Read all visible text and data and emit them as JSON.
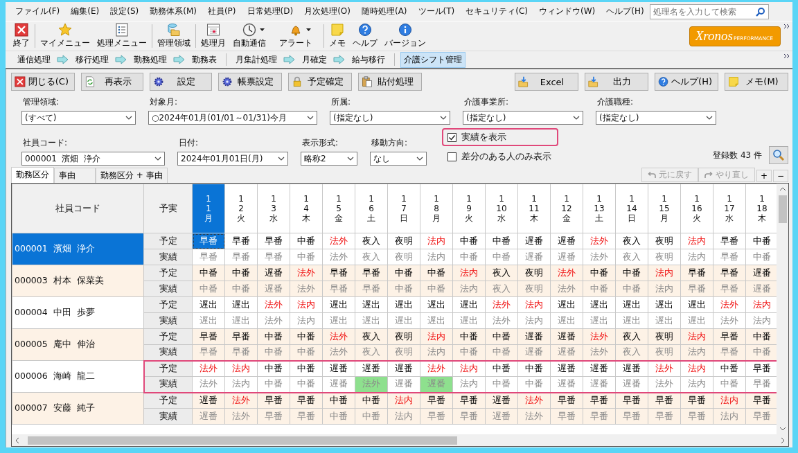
{
  "menu": [
    "ファイル(F)",
    "編集(E)",
    "設定(S)",
    "勤務体系(M)",
    "社員(P)",
    "日常処理(D)",
    "月次処理(O)",
    "随時処理(A)",
    "ツール(T)",
    "セキュリティ(C)",
    "ウィンドウ(W)",
    "ヘルプ(H)"
  ],
  "search": {
    "placeholder": "処理名を入力して検索"
  },
  "toolbar": [
    {
      "label": "終了",
      "dropdown": false
    },
    {
      "label": "マイメニュー",
      "dropdown": false
    },
    {
      "label": "処理メニュー",
      "dropdown": false
    },
    {
      "label": "管理領域",
      "dropdown": false
    },
    {
      "label": "処理月",
      "dropdown": false
    },
    {
      "label": "自動通信",
      "dropdown": true
    },
    {
      "label": "アラート",
      "dropdown": true
    },
    {
      "label": "メモ",
      "dropdown": false
    },
    {
      "label": "ヘルプ",
      "dropdown": false
    },
    {
      "label": "バージョン",
      "dropdown": false
    }
  ],
  "logo": {
    "name": "Xronos",
    "tagline": "PERFORMANCE"
  },
  "breadcrumb": [
    [
      {
        "label": "通信処理",
        "selected": false
      },
      {
        "label": "移行処理",
        "selected": false
      },
      {
        "label": "勤務処理",
        "selected": false
      },
      {
        "label": "勤務表",
        "selected": false
      }
    ],
    [
      {
        "label": "月集計処理",
        "selected": false
      },
      {
        "label": "月確定",
        "selected": false
      },
      {
        "label": "給与移行",
        "selected": false
      }
    ],
    [
      {
        "label": "介護シフト管理",
        "selected": true
      }
    ]
  ],
  "actions_left": [
    "閉じる(C)",
    "再表示",
    "設定",
    "帳票設定",
    "予定確定",
    "貼付処理"
  ],
  "actions_right": [
    "Excel",
    "出力",
    "ヘルプ(H)",
    "メモ(M)"
  ],
  "filters_row1": [
    {
      "label": "管理領域:",
      "value": "(すべて)"
    },
    {
      "label": "対象月:",
      "value": "○2024年01月(01/01～01/31)今月"
    },
    {
      "label": "所属:",
      "value": "(指定なし)"
    },
    {
      "label": "介護事業所:",
      "value": "(指定なし)"
    },
    {
      "label": "介護職種:",
      "value": "(指定なし)"
    }
  ],
  "filters_row2": [
    {
      "label": "社員コード:",
      "value": "000001  濱畑  浄介"
    },
    {
      "label": "日付:",
      "value": "2024年01月01日(月)"
    },
    {
      "label": "表示形式:",
      "value": "略称2"
    },
    {
      "label": "移動方向:",
      "value": "なし"
    }
  ],
  "checkboxes": [
    {
      "label": "実績を表示",
      "checked": true,
      "highlighted": true
    },
    {
      "label": "差分のある人のみ表示",
      "checked": false,
      "highlighted": false
    }
  ],
  "record_count": {
    "label": "登録数",
    "count": "43",
    "unit": "件"
  },
  "history_buttons": [
    {
      "label": "元に戻す",
      "disabled": true
    },
    {
      "label": "やり直し",
      "disabled": true
    }
  ],
  "zoom_buttons": [
    "+",
    "−"
  ],
  "tabs": [
    {
      "label": "勤務区分",
      "selected": true
    },
    {
      "label": "事由",
      "selected": false
    },
    {
      "label": "勤務区分 + 事由",
      "selected": false
    }
  ],
  "grid": {
    "columns": [
      "社員コード",
      "予実"
    ],
    "days": [
      {
        "month": "1",
        "day": "1",
        "weekday": "月",
        "selected": true
      },
      {
        "month": "1",
        "day": "2",
        "weekday": "火",
        "selected": false
      },
      {
        "month": "1",
        "day": "3",
        "weekday": "水",
        "selected": false
      },
      {
        "month": "1",
        "day": "4",
        "weekday": "木",
        "selected": false
      },
      {
        "month": "1",
        "day": "5",
        "weekday": "金",
        "selected": false
      },
      {
        "month": "1",
        "day": "6",
        "weekday": "土",
        "selected": false
      },
      {
        "month": "1",
        "day": "7",
        "weekday": "日",
        "selected": false
      },
      {
        "month": "1",
        "day": "8",
        "weekday": "月",
        "selected": false
      },
      {
        "month": "1",
        "day": "9",
        "weekday": "火",
        "selected": false
      },
      {
        "month": "1",
        "day": "10",
        "weekday": "水",
        "selected": false
      },
      {
        "month": "1",
        "day": "11",
        "weekday": "木",
        "selected": false
      },
      {
        "month": "1",
        "day": "12",
        "weekday": "金",
        "selected": false
      },
      {
        "month": "1",
        "day": "13",
        "weekday": "土",
        "selected": false
      },
      {
        "month": "1",
        "day": "14",
        "weekday": "日",
        "selected": false
      },
      {
        "month": "1",
        "day": "15",
        "weekday": "月",
        "selected": false
      },
      {
        "month": "1",
        "day": "16",
        "weekday": "火",
        "selected": false
      },
      {
        "month": "1",
        "day": "17",
        "weekday": "水",
        "selected": false
      },
      {
        "month": "1",
        "day": "18",
        "weekday": "木",
        "selected": false
      }
    ],
    "employees": [
      {
        "name": "000001  濱畑  浄介",
        "selected": true,
        "highlighted": false,
        "labels": [
          "予定",
          "実績"
        ],
        "plan": [
          {
            "text": "早番",
            "holiday": false
          },
          {
            "text": "早番",
            "holiday": false
          },
          {
            "text": "早番",
            "holiday": false
          },
          {
            "text": "中番",
            "holiday": false
          },
          {
            "text": "法外",
            "holiday": true
          },
          {
            "text": "夜入",
            "holiday": false
          },
          {
            "text": "夜明",
            "holiday": false
          },
          {
            "text": "法内",
            "holiday": true
          },
          {
            "text": "中番",
            "holiday": false
          },
          {
            "text": "中番",
            "holiday": false
          },
          {
            "text": "遅番",
            "holiday": false
          },
          {
            "text": "遅番",
            "holiday": false
          },
          {
            "text": "法外",
            "holiday": true
          },
          {
            "text": "夜入",
            "holiday": false
          },
          {
            "text": "夜明",
            "holiday": false
          },
          {
            "text": "法内",
            "holiday": true
          },
          {
            "text": "早番",
            "holiday": false
          },
          {
            "text": "中番",
            "holiday": false
          }
        ],
        "actual": [
          {
            "text": "早番",
            "differs": false
          },
          {
            "text": "早番",
            "differs": false
          },
          {
            "text": "早番",
            "differs": false
          },
          {
            "text": "中番",
            "differs": false
          },
          {
            "text": "法外",
            "differs": false
          },
          {
            "text": "夜入",
            "differs": false
          },
          {
            "text": "夜明",
            "differs": false
          },
          {
            "text": "法内",
            "differs": false
          },
          {
            "text": "中番",
            "differs": false
          },
          {
            "text": "中番",
            "differs": false
          },
          {
            "text": "遅番",
            "differs": false
          },
          {
            "text": "遅番",
            "differs": false
          },
          {
            "text": "法外",
            "differs": false
          },
          {
            "text": "夜入",
            "differs": false
          },
          {
            "text": "夜明",
            "differs": false
          },
          {
            "text": "法内",
            "differs": false
          },
          {
            "text": "早番",
            "differs": false
          },
          {
            "text": "中番",
            "differs": false
          }
        ]
      },
      {
        "name": "000003  村本  保菜美",
        "selected": false,
        "highlighted": false,
        "labels": [
          "予定",
          "実績"
        ],
        "plan": [
          {
            "text": "中番",
            "holiday": false
          },
          {
            "text": "中番",
            "holiday": false
          },
          {
            "text": "遅番",
            "holiday": false
          },
          {
            "text": "法外",
            "holiday": true
          },
          {
            "text": "早番",
            "holiday": false
          },
          {
            "text": "早番",
            "holiday": false
          },
          {
            "text": "中番",
            "holiday": false
          },
          {
            "text": "中番",
            "holiday": false
          },
          {
            "text": "法内",
            "holiday": true
          },
          {
            "text": "夜入",
            "holiday": false
          },
          {
            "text": "夜明",
            "holiday": false
          },
          {
            "text": "法外",
            "holiday": true
          },
          {
            "text": "中番",
            "holiday": false
          },
          {
            "text": "中番",
            "holiday": false
          },
          {
            "text": "法内",
            "holiday": true
          },
          {
            "text": "早番",
            "holiday": false
          },
          {
            "text": "早番",
            "holiday": false
          },
          {
            "text": "遅番",
            "holiday": false
          }
        ],
        "actual": [
          {
            "text": "中番",
            "differs": false
          },
          {
            "text": "中番",
            "differs": false
          },
          {
            "text": "遅番",
            "differs": false
          },
          {
            "text": "法外",
            "differs": false
          },
          {
            "text": "早番",
            "differs": false
          },
          {
            "text": "早番",
            "differs": false
          },
          {
            "text": "中番",
            "differs": false
          },
          {
            "text": "中番",
            "differs": false
          },
          {
            "text": "法内",
            "differs": false
          },
          {
            "text": "夜入",
            "differs": false
          },
          {
            "text": "夜明",
            "differs": false
          },
          {
            "text": "法外",
            "differs": false
          },
          {
            "text": "中番",
            "differs": false
          },
          {
            "text": "中番",
            "differs": false
          },
          {
            "text": "法内",
            "differs": false
          },
          {
            "text": "早番",
            "differs": false
          },
          {
            "text": "早番",
            "differs": false
          },
          {
            "text": "遅番",
            "differs": false
          }
        ]
      },
      {
        "name": "000004  中田  歩夢",
        "selected": false,
        "highlighted": false,
        "labels": [
          "予定",
          "実績"
        ],
        "plan": [
          {
            "text": "遅出",
            "holiday": false
          },
          {
            "text": "遅出",
            "holiday": false
          },
          {
            "text": "法外",
            "holiday": true
          },
          {
            "text": "法内",
            "holiday": true
          },
          {
            "text": "遅出",
            "holiday": false
          },
          {
            "text": "遅出",
            "holiday": false
          },
          {
            "text": "遅出",
            "holiday": false
          },
          {
            "text": "遅出",
            "holiday": false
          },
          {
            "text": "遅出",
            "holiday": false
          },
          {
            "text": "法外",
            "holiday": true
          },
          {
            "text": "法内",
            "holiday": true
          },
          {
            "text": "遅出",
            "holiday": false
          },
          {
            "text": "遅出",
            "holiday": false
          },
          {
            "text": "遅出",
            "holiday": false
          },
          {
            "text": "遅出",
            "holiday": false
          },
          {
            "text": "遅出",
            "holiday": false
          },
          {
            "text": "法外",
            "holiday": true
          },
          {
            "text": "法内",
            "holiday": true
          }
        ],
        "actual": [
          {
            "text": "遅出",
            "differs": false
          },
          {
            "text": "遅出",
            "differs": false
          },
          {
            "text": "法外",
            "differs": false
          },
          {
            "text": "法内",
            "differs": false
          },
          {
            "text": "遅出",
            "differs": false
          },
          {
            "text": "遅出",
            "differs": false
          },
          {
            "text": "遅出",
            "differs": false
          },
          {
            "text": "遅出",
            "differs": false
          },
          {
            "text": "遅出",
            "differs": false
          },
          {
            "text": "法外",
            "differs": false
          },
          {
            "text": "法内",
            "differs": false
          },
          {
            "text": "遅出",
            "differs": false
          },
          {
            "text": "遅出",
            "differs": false
          },
          {
            "text": "遅出",
            "differs": false
          },
          {
            "text": "遅出",
            "differs": false
          },
          {
            "text": "遅出",
            "differs": false
          },
          {
            "text": "法外",
            "differs": false
          },
          {
            "text": "法内",
            "differs": false
          }
        ]
      },
      {
        "name": "000005  庵中  伸治",
        "selected": false,
        "highlighted": false,
        "labels": [
          "予定",
          "実績"
        ],
        "plan": [
          {
            "text": "早番",
            "holiday": false
          },
          {
            "text": "早番",
            "holiday": false
          },
          {
            "text": "中番",
            "holiday": false
          },
          {
            "text": "中番",
            "holiday": false
          },
          {
            "text": "法外",
            "holiday": true
          },
          {
            "text": "夜入",
            "holiday": false
          },
          {
            "text": "夜明",
            "holiday": false
          },
          {
            "text": "法内",
            "holiday": true
          },
          {
            "text": "中番",
            "holiday": false
          },
          {
            "text": "中番",
            "holiday": false
          },
          {
            "text": "遅番",
            "holiday": false
          },
          {
            "text": "遅番",
            "holiday": false
          },
          {
            "text": "法外",
            "holiday": true
          },
          {
            "text": "夜入",
            "holiday": false
          },
          {
            "text": "夜明",
            "holiday": false
          },
          {
            "text": "法内",
            "holiday": true
          },
          {
            "text": "早番",
            "holiday": false
          },
          {
            "text": "中番",
            "holiday": false
          }
        ],
        "actual": [
          {
            "text": "早番",
            "differs": false
          },
          {
            "text": "早番",
            "differs": false
          },
          {
            "text": "中番",
            "differs": false
          },
          {
            "text": "中番",
            "differs": false
          },
          {
            "text": "法外",
            "differs": false
          },
          {
            "text": "夜入",
            "differs": false
          },
          {
            "text": "夜明",
            "differs": false
          },
          {
            "text": "法内",
            "differs": false
          },
          {
            "text": "中番",
            "differs": false
          },
          {
            "text": "中番",
            "differs": false
          },
          {
            "text": "遅番",
            "differs": false
          },
          {
            "text": "遅番",
            "differs": false
          },
          {
            "text": "法外",
            "differs": false
          },
          {
            "text": "夜入",
            "differs": false
          },
          {
            "text": "夜明",
            "differs": false
          },
          {
            "text": "法内",
            "differs": false
          },
          {
            "text": "早番",
            "differs": false
          },
          {
            "text": "中番",
            "differs": false
          }
        ]
      },
      {
        "name": "000006  海崎  龍二",
        "selected": false,
        "highlighted": true,
        "labels": [
          "予定",
          "実績"
        ],
        "plan": [
          {
            "text": "法外",
            "holiday": true
          },
          {
            "text": "法内",
            "holiday": true
          },
          {
            "text": "中番",
            "holiday": false
          },
          {
            "text": "中番",
            "holiday": false
          },
          {
            "text": "遅番",
            "holiday": false
          },
          {
            "text": "遅番",
            "holiday": false
          },
          {
            "text": "遅番",
            "holiday": false
          },
          {
            "text": "法外",
            "holiday": true
          },
          {
            "text": "法内",
            "holiday": true
          },
          {
            "text": "中番",
            "holiday": false
          },
          {
            "text": "中番",
            "holiday": false
          },
          {
            "text": "遅番",
            "holiday": false
          },
          {
            "text": "遅番",
            "holiday": false
          },
          {
            "text": "遅番",
            "holiday": false
          },
          {
            "text": "法外",
            "holiday": true
          },
          {
            "text": "法内",
            "holiday": true
          },
          {
            "text": "中番",
            "holiday": false
          },
          {
            "text": "早番",
            "holiday": false
          }
        ],
        "actual": [
          {
            "text": "法外",
            "differs": false
          },
          {
            "text": "法内",
            "differs": false
          },
          {
            "text": "中番",
            "differs": false
          },
          {
            "text": "中番",
            "differs": false
          },
          {
            "text": "遅番",
            "differs": false
          },
          {
            "text": "法外",
            "differs": true
          },
          {
            "text": "遅番",
            "differs": false
          },
          {
            "text": "遅番",
            "differs": true
          },
          {
            "text": "法内",
            "differs": false
          },
          {
            "text": "中番",
            "differs": false
          },
          {
            "text": "中番",
            "differs": false
          },
          {
            "text": "遅番",
            "differs": false
          },
          {
            "text": "遅番",
            "differs": false
          },
          {
            "text": "遅番",
            "differs": false
          },
          {
            "text": "法外",
            "differs": false
          },
          {
            "text": "法内",
            "differs": false
          },
          {
            "text": "中番",
            "differs": false
          },
          {
            "text": "早番",
            "differs": false
          }
        ]
      },
      {
        "name": "000007  安藤  純子",
        "selected": false,
        "highlighted": false,
        "labels": [
          "予定",
          "実績"
        ],
        "plan": [
          {
            "text": "遅番",
            "holiday": false
          },
          {
            "text": "法外",
            "holiday": true
          },
          {
            "text": "早番",
            "holiday": false
          },
          {
            "text": "早番",
            "holiday": false
          },
          {
            "text": "中番",
            "holiday": false
          },
          {
            "text": "中番",
            "holiday": false
          },
          {
            "text": "法内",
            "holiday": true
          },
          {
            "text": "早番",
            "holiday": false
          },
          {
            "text": "早番",
            "holiday": false
          },
          {
            "text": "遅番",
            "holiday": false
          },
          {
            "text": "法外",
            "holiday": true
          },
          {
            "text": "早番",
            "holiday": false
          },
          {
            "text": "早番",
            "holiday": false
          },
          {
            "text": "早番",
            "holiday": false
          },
          {
            "text": "早番",
            "holiday": false
          },
          {
            "text": "早番",
            "holiday": false
          },
          {
            "text": "法内",
            "holiday": true
          },
          {
            "text": "早番",
            "holiday": false
          }
        ],
        "actual": [
          {
            "text": "遅番",
            "differs": false
          },
          {
            "text": "法外",
            "differs": false
          },
          {
            "text": "早番",
            "differs": false
          },
          {
            "text": "早番",
            "differs": false
          },
          {
            "text": "中番",
            "differs": false
          },
          {
            "text": "中番",
            "differs": false
          },
          {
            "text": "法内",
            "differs": false
          },
          {
            "text": "早番",
            "differs": false
          },
          {
            "text": "早番",
            "differs": false
          },
          {
            "text": "遅番",
            "differs": false
          },
          {
            "text": "法外",
            "differs": false
          },
          {
            "text": "早番",
            "differs": false
          },
          {
            "text": "早番",
            "differs": false
          },
          {
            "text": "早番",
            "differs": false
          },
          {
            "text": "早番",
            "differs": false
          },
          {
            "text": "早番",
            "differs": false
          },
          {
            "text": "法内",
            "differs": false
          },
          {
            "text": "早番",
            "differs": false
          }
        ]
      }
    ]
  }
}
